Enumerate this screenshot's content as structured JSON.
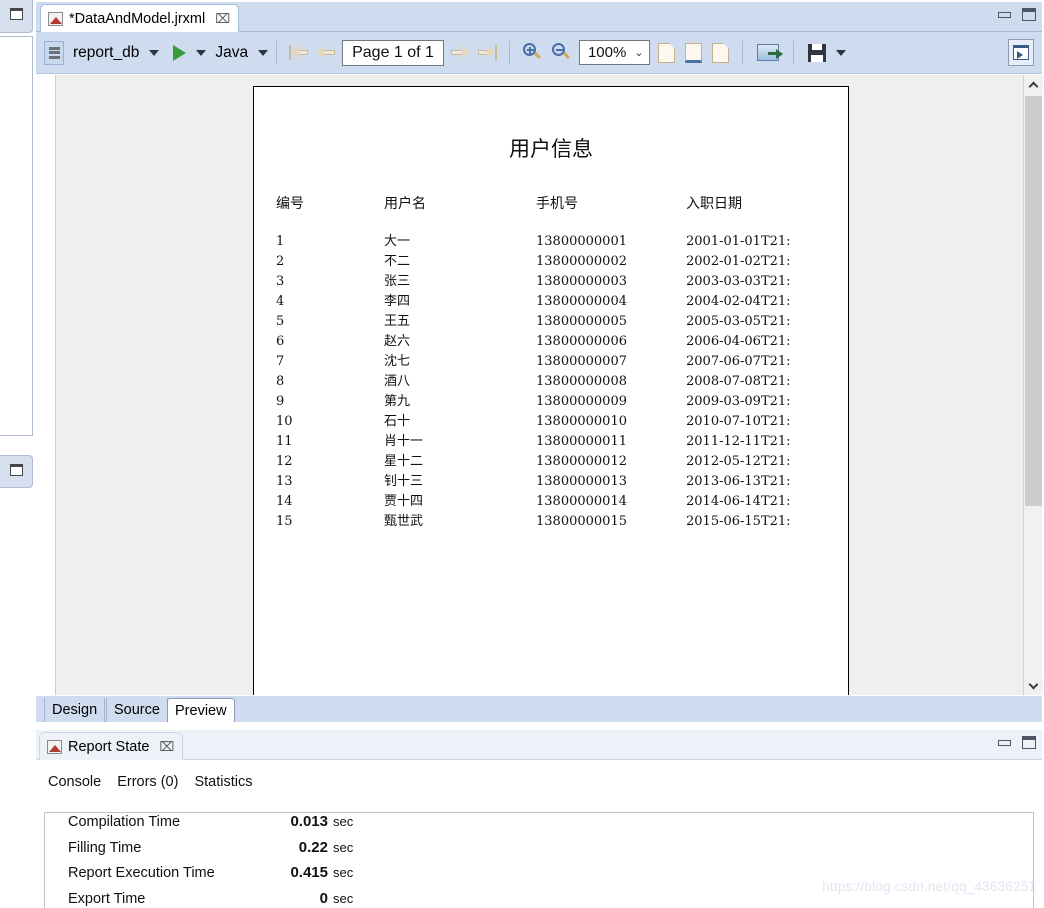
{
  "window": {
    "minimize_label": "Minimize",
    "maximize_label": "Maximize"
  },
  "editor": {
    "tab_title": "*DataAndModel.jrxml",
    "tab_close": "⌧",
    "tab_icon": "report-file-icon"
  },
  "toolbar": {
    "datasource": "report_db",
    "datasource_icon": "database-icon",
    "run_icon": "run-play-icon",
    "language": "Java",
    "first_page_tooltip": "First page",
    "prev_page_tooltip": "Previous page",
    "page_indicator": "Page 1 of 1",
    "next_page_tooltip": "Next page",
    "last_page_tooltip": "Last page",
    "zoom_in_icon": "zoom-in-icon",
    "zoom_out_icon": "zoom-out-icon",
    "zoom_value": "100%",
    "zoom_chevron": "⌄",
    "fit_actual_icon": "page-actual-size-icon",
    "fit_width_icon": "fit-page-width-icon",
    "fit_page_icon": "fit-whole-page-icon",
    "export_icon": "export-icon",
    "save_icon": "save-icon",
    "save_caret": "save-dropdown-caret",
    "maximize_panel_icon": "maximize-panel-icon"
  },
  "report": {
    "title": "用户信息",
    "columns": [
      "编号",
      "用户名",
      "手机号",
      "入职日期"
    ],
    "rows": [
      [
        "1",
        "大一",
        "13800000001",
        "2001-01-01T21:"
      ],
      [
        "2",
        "不二",
        "13800000002",
        "2002-01-02T21:"
      ],
      [
        "3",
        "张三",
        "13800000003",
        "2003-03-03T21:"
      ],
      [
        "4",
        "李四",
        "13800000004",
        "2004-02-04T21:"
      ],
      [
        "5",
        "王五",
        "13800000005",
        "2005-03-05T21:"
      ],
      [
        "6",
        "赵六",
        "13800000006",
        "2006-04-06T21:"
      ],
      [
        "7",
        "沈七",
        "13800000007",
        "2007-06-07T21:"
      ],
      [
        "8",
        "酒八",
        "13800000008",
        "2008-07-08T21:"
      ],
      [
        "9",
        "第九",
        "13800000009",
        "2009-03-09T21:"
      ],
      [
        "10",
        "石十",
        "13800000010",
        "2010-07-10T21:"
      ],
      [
        "11",
        "肖十一",
        "13800000011",
        "2011-12-11T21:"
      ],
      [
        "12",
        "星十二",
        "13800000012",
        "2012-05-12T21:"
      ],
      [
        "13",
        "钊十三",
        "13800000013",
        "2013-06-13T21:"
      ],
      [
        "14",
        "贾十四",
        "13800000014",
        "2014-06-14T21:"
      ],
      [
        "15",
        "甄世武",
        "13800000015",
        "2015-06-15T21:"
      ]
    ]
  },
  "editor_tabs": [
    {
      "label": "Design",
      "selected": false
    },
    {
      "label": "Source",
      "selected": false
    },
    {
      "label": "Preview",
      "selected": true
    }
  ],
  "report_state": {
    "tab_title": "Report State",
    "tab_close": "⌧",
    "tab_icon": "report-file-icon",
    "subtabs": [
      {
        "label": "Console",
        "selected": false
      },
      {
        "label": "Errors (0)",
        "selected": false
      },
      {
        "label": "Statistics",
        "selected": true
      }
    ],
    "stats": [
      {
        "name": "Compilation Time",
        "value": "0.013",
        "unit": "sec"
      },
      {
        "name": "Filling Time",
        "value": "0.22",
        "unit": "sec"
      },
      {
        "name": "Report Execution Time",
        "value": "0.415",
        "unit": "sec"
      },
      {
        "name": "Export Time",
        "value": "0",
        "unit": "sec"
      }
    ]
  },
  "watermark": "https://blog.csdn.net/qq_43636251",
  "colors": {
    "toolbar_bg": "#cfdcef",
    "viewport_bg": "#efefef",
    "page_bg": "#ffffff",
    "accent": "#4a6fa5",
    "run_green": "#3a9b3a"
  }
}
